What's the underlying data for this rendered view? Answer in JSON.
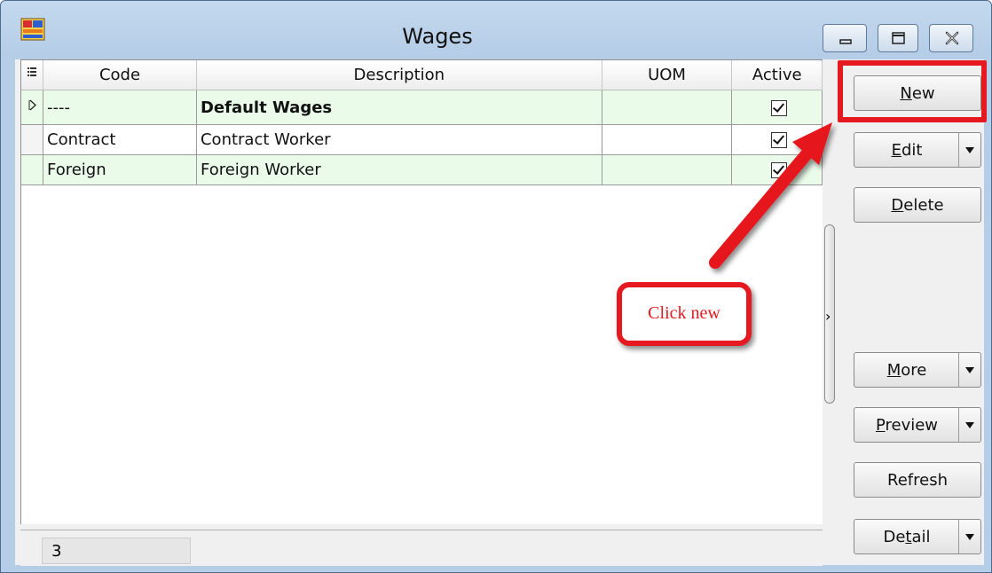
{
  "window": {
    "title": "Wages",
    "app_icon": "wages-app-icon",
    "controls": [
      "minimize-icon",
      "restore-icon",
      "close-icon"
    ]
  },
  "grid": {
    "columns": [
      "Code",
      "Description",
      "UOM",
      "Active"
    ],
    "rows": [
      {
        "code": "----",
        "description": "Default Wages",
        "uom": "",
        "active": true
      },
      {
        "code": "Contract",
        "description": "Contract Worker",
        "uom": "",
        "active": true
      },
      {
        "code": "Foreign",
        "description": "Foreign Worker",
        "uom": "",
        "active": true
      }
    ],
    "record_count": "3"
  },
  "buttons": {
    "new": "New",
    "edit": "Edit",
    "delete": "Delete",
    "more": "More",
    "preview": "Preview",
    "refresh": "Refresh",
    "detail": "Detail"
  },
  "annotation": {
    "callout_text": "Click new",
    "color": "#e5191f"
  }
}
